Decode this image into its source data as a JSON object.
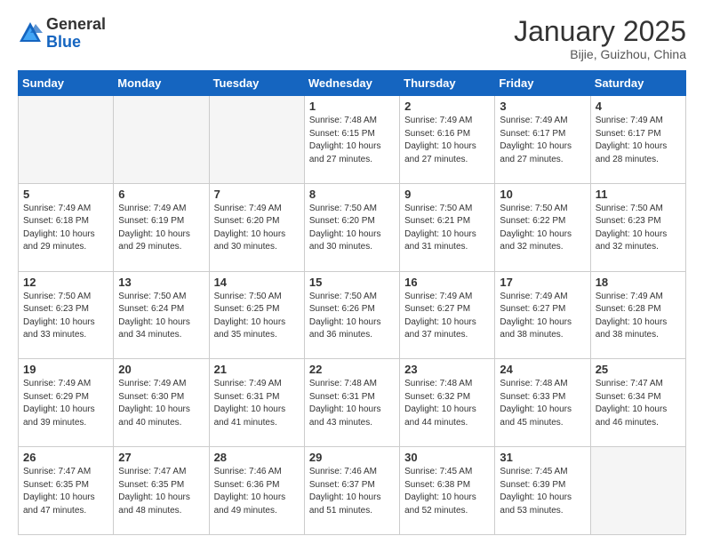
{
  "header": {
    "logo_general": "General",
    "logo_blue": "Blue",
    "month_title": "January 2025",
    "location": "Bijie, Guizhou, China"
  },
  "weekdays": [
    "Sunday",
    "Monday",
    "Tuesday",
    "Wednesday",
    "Thursday",
    "Friday",
    "Saturday"
  ],
  "weeks": [
    [
      {
        "day": "",
        "info": ""
      },
      {
        "day": "",
        "info": ""
      },
      {
        "day": "",
        "info": ""
      },
      {
        "day": "1",
        "info": "Sunrise: 7:48 AM\nSunset: 6:15 PM\nDaylight: 10 hours\nand 27 minutes."
      },
      {
        "day": "2",
        "info": "Sunrise: 7:49 AM\nSunset: 6:16 PM\nDaylight: 10 hours\nand 27 minutes."
      },
      {
        "day": "3",
        "info": "Sunrise: 7:49 AM\nSunset: 6:17 PM\nDaylight: 10 hours\nand 27 minutes."
      },
      {
        "day": "4",
        "info": "Sunrise: 7:49 AM\nSunset: 6:17 PM\nDaylight: 10 hours\nand 28 minutes."
      }
    ],
    [
      {
        "day": "5",
        "info": "Sunrise: 7:49 AM\nSunset: 6:18 PM\nDaylight: 10 hours\nand 29 minutes."
      },
      {
        "day": "6",
        "info": "Sunrise: 7:49 AM\nSunset: 6:19 PM\nDaylight: 10 hours\nand 29 minutes."
      },
      {
        "day": "7",
        "info": "Sunrise: 7:49 AM\nSunset: 6:20 PM\nDaylight: 10 hours\nand 30 minutes."
      },
      {
        "day": "8",
        "info": "Sunrise: 7:50 AM\nSunset: 6:20 PM\nDaylight: 10 hours\nand 30 minutes."
      },
      {
        "day": "9",
        "info": "Sunrise: 7:50 AM\nSunset: 6:21 PM\nDaylight: 10 hours\nand 31 minutes."
      },
      {
        "day": "10",
        "info": "Sunrise: 7:50 AM\nSunset: 6:22 PM\nDaylight: 10 hours\nand 32 minutes."
      },
      {
        "day": "11",
        "info": "Sunrise: 7:50 AM\nSunset: 6:23 PM\nDaylight: 10 hours\nand 32 minutes."
      }
    ],
    [
      {
        "day": "12",
        "info": "Sunrise: 7:50 AM\nSunset: 6:23 PM\nDaylight: 10 hours\nand 33 minutes."
      },
      {
        "day": "13",
        "info": "Sunrise: 7:50 AM\nSunset: 6:24 PM\nDaylight: 10 hours\nand 34 minutes."
      },
      {
        "day": "14",
        "info": "Sunrise: 7:50 AM\nSunset: 6:25 PM\nDaylight: 10 hours\nand 35 minutes."
      },
      {
        "day": "15",
        "info": "Sunrise: 7:50 AM\nSunset: 6:26 PM\nDaylight: 10 hours\nand 36 minutes."
      },
      {
        "day": "16",
        "info": "Sunrise: 7:49 AM\nSunset: 6:27 PM\nDaylight: 10 hours\nand 37 minutes."
      },
      {
        "day": "17",
        "info": "Sunrise: 7:49 AM\nSunset: 6:27 PM\nDaylight: 10 hours\nand 38 minutes."
      },
      {
        "day": "18",
        "info": "Sunrise: 7:49 AM\nSunset: 6:28 PM\nDaylight: 10 hours\nand 38 minutes."
      }
    ],
    [
      {
        "day": "19",
        "info": "Sunrise: 7:49 AM\nSunset: 6:29 PM\nDaylight: 10 hours\nand 39 minutes."
      },
      {
        "day": "20",
        "info": "Sunrise: 7:49 AM\nSunset: 6:30 PM\nDaylight: 10 hours\nand 40 minutes."
      },
      {
        "day": "21",
        "info": "Sunrise: 7:49 AM\nSunset: 6:31 PM\nDaylight: 10 hours\nand 41 minutes."
      },
      {
        "day": "22",
        "info": "Sunrise: 7:48 AM\nSunset: 6:31 PM\nDaylight: 10 hours\nand 43 minutes."
      },
      {
        "day": "23",
        "info": "Sunrise: 7:48 AM\nSunset: 6:32 PM\nDaylight: 10 hours\nand 44 minutes."
      },
      {
        "day": "24",
        "info": "Sunrise: 7:48 AM\nSunset: 6:33 PM\nDaylight: 10 hours\nand 45 minutes."
      },
      {
        "day": "25",
        "info": "Sunrise: 7:47 AM\nSunset: 6:34 PM\nDaylight: 10 hours\nand 46 minutes."
      }
    ],
    [
      {
        "day": "26",
        "info": "Sunrise: 7:47 AM\nSunset: 6:35 PM\nDaylight: 10 hours\nand 47 minutes."
      },
      {
        "day": "27",
        "info": "Sunrise: 7:47 AM\nSunset: 6:35 PM\nDaylight: 10 hours\nand 48 minutes."
      },
      {
        "day": "28",
        "info": "Sunrise: 7:46 AM\nSunset: 6:36 PM\nDaylight: 10 hours\nand 49 minutes."
      },
      {
        "day": "29",
        "info": "Sunrise: 7:46 AM\nSunset: 6:37 PM\nDaylight: 10 hours\nand 51 minutes."
      },
      {
        "day": "30",
        "info": "Sunrise: 7:45 AM\nSunset: 6:38 PM\nDaylight: 10 hours\nand 52 minutes."
      },
      {
        "day": "31",
        "info": "Sunrise: 7:45 AM\nSunset: 6:39 PM\nDaylight: 10 hours\nand 53 minutes."
      },
      {
        "day": "",
        "info": ""
      }
    ]
  ]
}
